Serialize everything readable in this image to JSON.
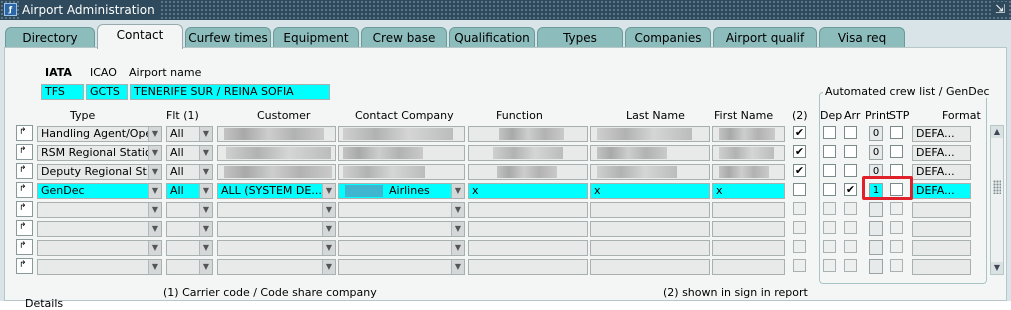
{
  "window": {
    "title": "Airport Administration",
    "close_glyph": "⇲"
  },
  "tabs": [
    {
      "label": "Directory"
    },
    {
      "label": "Contact"
    },
    {
      "label": "Curfew times"
    },
    {
      "label": "Equipment"
    },
    {
      "label": "Crew base"
    },
    {
      "label": "Qualification"
    },
    {
      "label": "Types"
    },
    {
      "label": "Companies"
    },
    {
      "label": "Airport qualif type"
    },
    {
      "label": "Visa req"
    }
  ],
  "airport": {
    "iata_label": "IATA",
    "icao_label": "ICAO",
    "name_label": "Airport name",
    "iata": "TFS",
    "icao": "GCTS",
    "name": "TENERIFE SUR / REINA SOFIA"
  },
  "group_label": "Automated crew list / GenDec",
  "headers": {
    "type": "Type",
    "flt": "Flt (1)",
    "customer": "Customer",
    "contact_company": "Contact Company",
    "function": "Function",
    "last_name": "Last Name",
    "first_name": "First Name",
    "col2": "(2)",
    "dep": "Dep",
    "arr": "Arr",
    "print": "Print",
    "stp": "STP",
    "format": "Format"
  },
  "rows": [
    {
      "type": "Handling Agent/Ope...",
      "flt": "All",
      "c2": "✔",
      "arr": "",
      "print": "0",
      "format": "DEFA..."
    },
    {
      "type": "RSM Regional Statio...",
      "flt": "All",
      "c2": "✔",
      "arr": "",
      "print": "0",
      "format": "DEFA..."
    },
    {
      "type": "Deputy Regional St...",
      "flt": "All",
      "c2": "✔",
      "arr": "",
      "print": "0",
      "format": "DEFA..."
    },
    {
      "type": "GenDec",
      "flt": "All",
      "customer": "ALL (SYSTEM DE...",
      "contact_company": "Airlines",
      "function": "x",
      "last_name": "x",
      "first_name": "x",
      "c2": "",
      "arr": "✔",
      "print": "1",
      "format": "DEFA..."
    }
  ],
  "footer": {
    "note1": "(1) Carrier code / Code share company",
    "note2": "(2) shown in sign in report",
    "details": "Details"
  }
}
